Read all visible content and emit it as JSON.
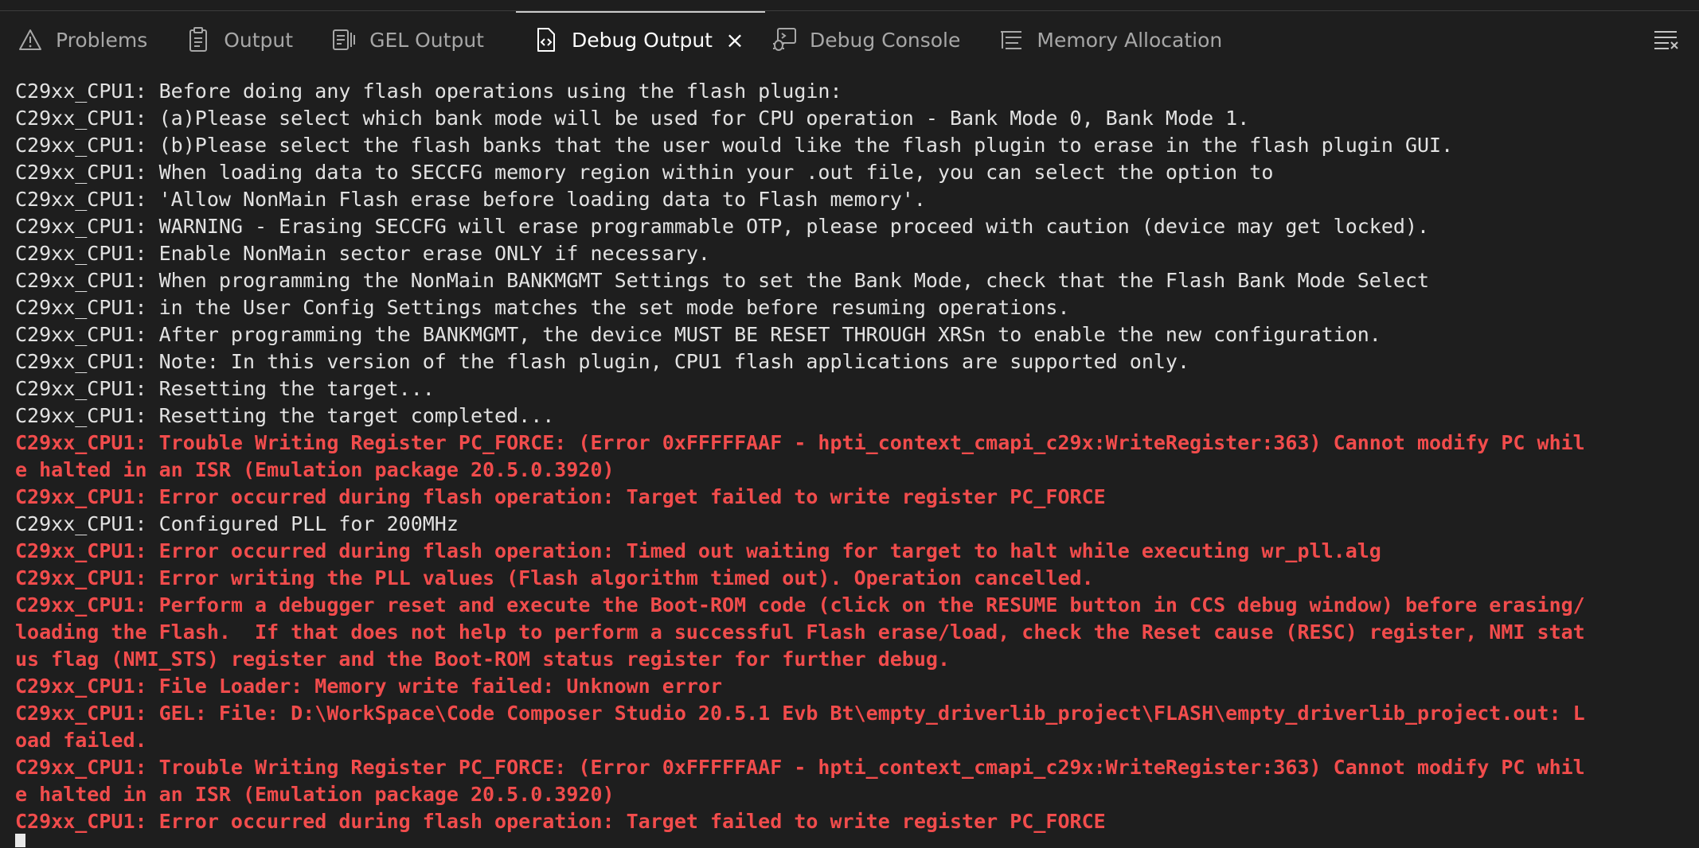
{
  "tabs": [
    {
      "label": "Problems",
      "icon": "warning-triangle-icon",
      "active": false
    },
    {
      "label": "Output",
      "icon": "clipboard-icon",
      "active": false
    },
    {
      "label": "GEL Output",
      "icon": "gel-document-icon",
      "active": false
    },
    {
      "label": "Debug Output",
      "icon": "code-file-icon",
      "active": true
    },
    {
      "label": "Debug Console",
      "icon": "debug-console-icon",
      "active": false
    },
    {
      "label": "Memory Allocation",
      "icon": "memory-allocation-icon",
      "active": false
    }
  ],
  "close_icon": "×",
  "panel_menu_icon": "hamburger-menu-icon",
  "colors": {
    "background": "#1e1e1e",
    "text": "#e2e2e2",
    "error": "#f14c4c",
    "tab_inactive": "#a7a7a7",
    "tab_active": "#ffffff"
  },
  "lines": [
    {
      "text": "C29xx_CPU1: Before doing any flash operations using the flash plugin:",
      "error": false
    },
    {
      "text": "C29xx_CPU1: (a)Please select which bank mode will be used for CPU operation - Bank Mode 0, Bank Mode 1.",
      "error": false
    },
    {
      "text": "C29xx_CPU1: (b)Please select the flash banks that the user would like the flash plugin to erase in the flash plugin GUI.",
      "error": false
    },
    {
      "text": "C29xx_CPU1: When loading data to SECCFG memory region within your .out file, you can select the option to",
      "error": false
    },
    {
      "text": "C29xx_CPU1: 'Allow NonMain Flash erase before loading data to Flash memory'.",
      "error": false
    },
    {
      "text": "C29xx_CPU1: WARNING - Erasing SECCFG will erase programmable OTP, please proceed with caution (device may get locked).",
      "error": false
    },
    {
      "text": "C29xx_CPU1: Enable NonMain sector erase ONLY if necessary.",
      "error": false
    },
    {
      "text": "C29xx_CPU1: When programming the NonMain BANKMGMT Settings to set the Bank Mode, check that the Flash Bank Mode Select",
      "error": false
    },
    {
      "text": "C29xx_CPU1: in the User Config Settings matches the set mode before resuming operations.",
      "error": false
    },
    {
      "text": "C29xx_CPU1: After programming the BANKMGMT, the device MUST BE RESET THROUGH XRSn to enable the new configuration.",
      "error": false
    },
    {
      "text": "C29xx_CPU1: Note: In this version of the flash plugin, CPU1 flash applications are supported only.",
      "error": false
    },
    {
      "text": "C29xx_CPU1: Resetting the target...",
      "error": false
    },
    {
      "text": "C29xx_CPU1: Resetting the target completed...",
      "error": false
    },
    {
      "text": "C29xx_CPU1: Trouble Writing Register PC_FORCE: (Error 0xFFFFFAAF - hpti_context_cmapi_c29x:WriteRegister:363) Cannot modify PC whil",
      "error": true
    },
    {
      "text": "e halted in an ISR (Emulation package 20.5.0.3920)",
      "error": true
    },
    {
      "text": "C29xx_CPU1: Error occurred during flash operation: Target failed to write register PC_FORCE",
      "error": true
    },
    {
      "text": "C29xx_CPU1: Configured PLL for 200MHz",
      "error": false
    },
    {
      "text": "C29xx_CPU1: Error occurred during flash operation: Timed out waiting for target to halt while executing wr_pll.alg",
      "error": true
    },
    {
      "text": "C29xx_CPU1: Error writing the PLL values (Flash algorithm timed out). Operation cancelled.",
      "error": true
    },
    {
      "text": "C29xx_CPU1: Perform a debugger reset and execute the Boot-ROM code (click on the RESUME button in CCS debug window) before erasing/",
      "error": true
    },
    {
      "text": "loading the Flash.  If that does not help to perform a successful Flash erase/load, check the Reset cause (RESC) register, NMI stat",
      "error": true
    },
    {
      "text": "us flag (NMI_STS) register and the Boot-ROM status register for further debug.",
      "error": true
    },
    {
      "text": "C29xx_CPU1: File Loader: Memory write failed: Unknown error",
      "error": true
    },
    {
      "text": "C29xx_CPU1: GEL: File: D:\\WorkSpace\\Code Composer Studio 20.5.1 Evb Bt\\empty_driverlib_project\\FLASH\\empty_driverlib_project.out: L",
      "error": true
    },
    {
      "text": "oad failed.",
      "error": true
    },
    {
      "text": "C29xx_CPU1: Trouble Writing Register PC_FORCE: (Error 0xFFFFFAAF - hpti_context_cmapi_c29x:WriteRegister:363) Cannot modify PC whil",
      "error": true
    },
    {
      "text": "e halted in an ISR (Emulation package 20.5.0.3920)",
      "error": true
    },
    {
      "text": "C29xx_CPU1: Error occurred during flash operation: Target failed to write register PC_FORCE",
      "error": true
    }
  ]
}
